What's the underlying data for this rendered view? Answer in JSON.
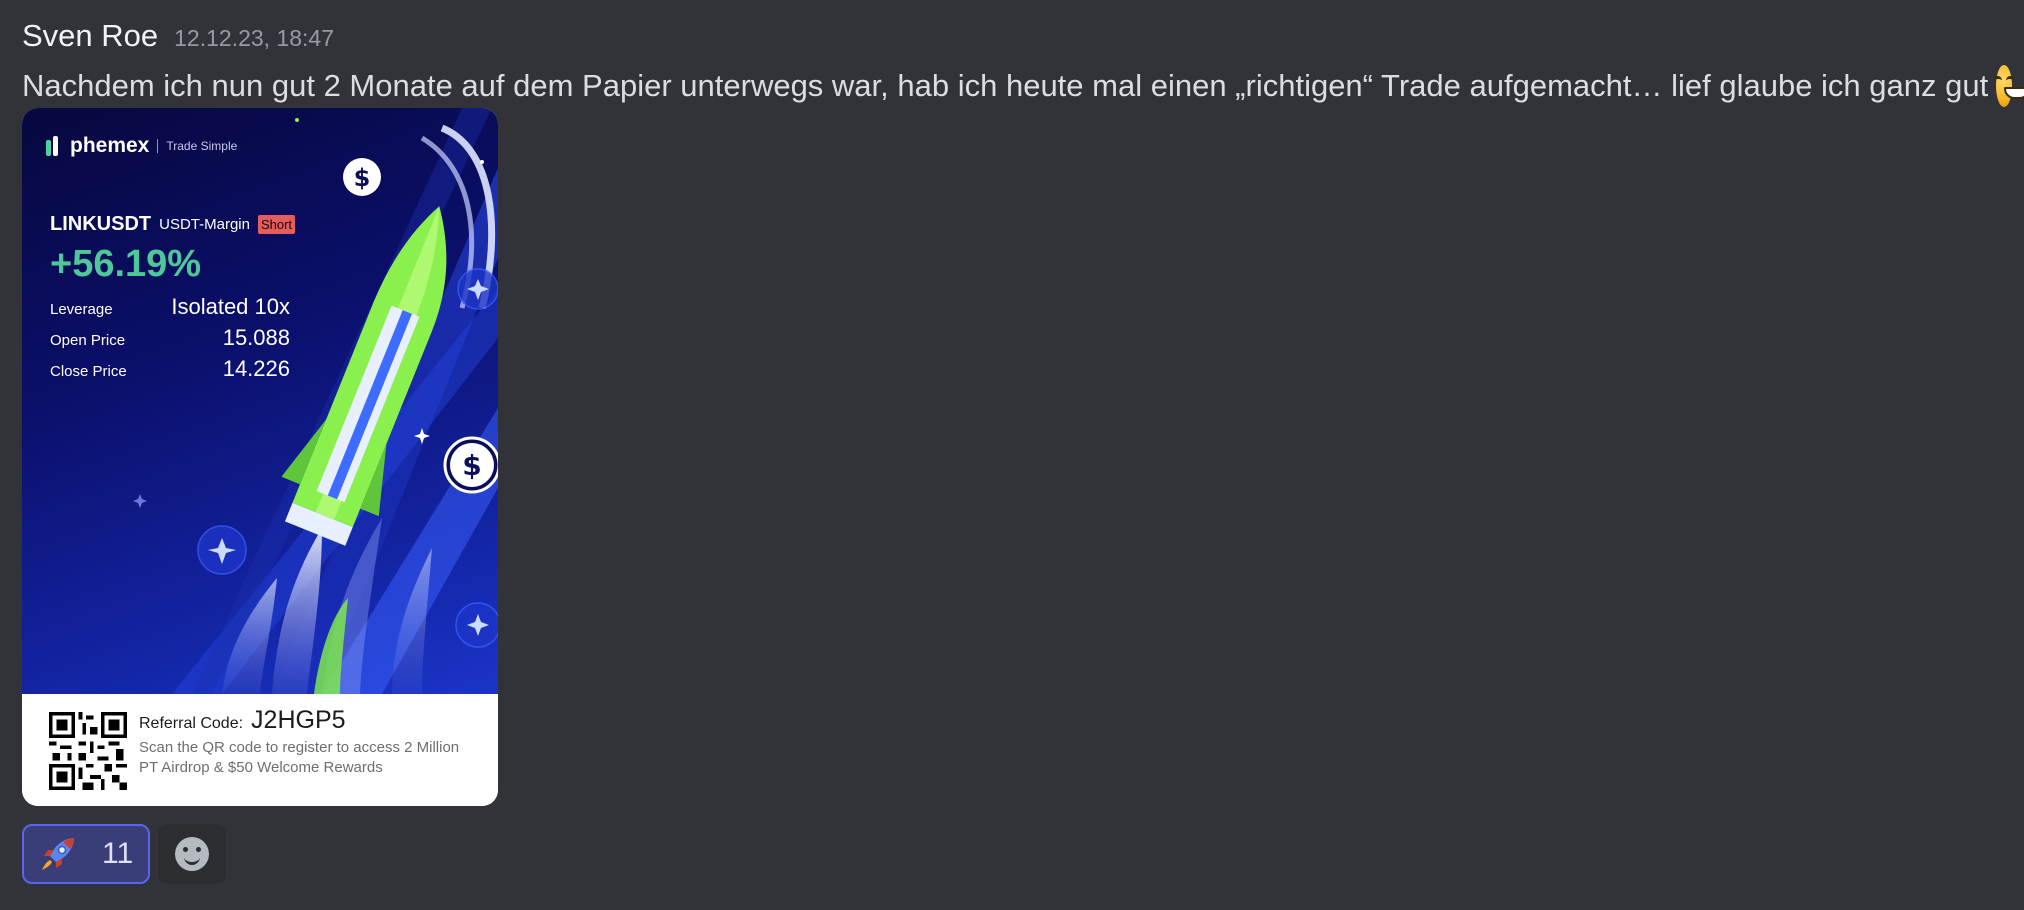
{
  "message": {
    "username": "Sven Roe",
    "timestamp": "12.12.23, 18:47",
    "text": "Nachdem ich nun gut 2 Monate auf dem Papier unterwegs war, hab ich heute mal einen „richtigen“ Trade aufgemacht… lief glaube ich ganz gut",
    "trailing_emoji": "grinning-face-with-smiling-eyes"
  },
  "card": {
    "brand": "phemex",
    "tagline": "Trade Simple",
    "pair": "LINKUSDT",
    "margin_type": "USDT-Margin",
    "side": "Short",
    "pnl": "+56.19%",
    "stats": [
      {
        "label": "Leverage",
        "value": "Isolated 10x"
      },
      {
        "label": "Open Price",
        "value": "15.088"
      },
      {
        "label": "Close Price",
        "value": "14.226"
      }
    ],
    "referral_label": "Referral Code:",
    "referral_code": "J2HGP5",
    "referral_desc": "Scan the QR code to register to access 2 Million PT Airdrop & $50 Welcome Rewards"
  },
  "reactions": [
    {
      "emoji": "rocket",
      "count": "11",
      "selected": true
    }
  ],
  "add_reaction_icon": "add-reaction-smile-icon",
  "colors": {
    "background": "#313338",
    "accent": "#5865f2",
    "pnl_green": "#4ec89a",
    "short_red": "#e35d5d"
  }
}
